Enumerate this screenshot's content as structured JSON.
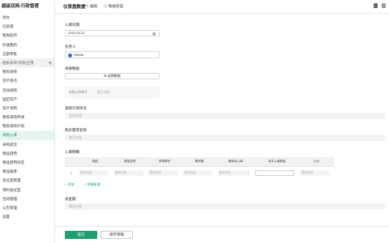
{
  "app": {
    "title": "超级双网-行政管理"
  },
  "sidebar": {
    "items": [
      {
        "label": "待办"
      },
      {
        "label": "已处理"
      },
      {
        "label": "我发起的"
      },
      {
        "label": "抄送我的"
      },
      {
        "label": "全部审批"
      },
      {
        "label": "搜索表单/流程/应用"
      },
      {
        "label": "物资采购"
      },
      {
        "label": "资产盘点"
      },
      {
        "label": "活动采购"
      },
      {
        "label": "固定资产"
      },
      {
        "label": "资产领用"
      },
      {
        "label": "物资采购申请"
      },
      {
        "label": "物资采购计划"
      },
      {
        "label": "采购入库"
      },
      {
        "label": "采购退货"
      },
      {
        "label": "物品借用"
      },
      {
        "label": "物品借用归还"
      },
      {
        "label": "物品报废"
      },
      {
        "label": "会议室管理"
      },
      {
        "label": "预约会议室"
      },
      {
        "label": "活动管理"
      },
      {
        "label": "公告管理"
      },
      {
        "label": "设置"
      }
    ],
    "plus": "+"
  },
  "topbar": {
    "title": "仪表盘数据",
    "edit": "✎ 编辑",
    "data": "▤ 数据管理"
  },
  "form": {
    "date_label": "入库日期",
    "date_value": "2024-05-22",
    "date_icon": "▦",
    "person_label": "负责人",
    "person_name": "Official",
    "related_label": "关联数据",
    "select_btn": "⊞ 选择数据",
    "sub_label1": "采购计划单号",
    "sub_value1": "暂无内容",
    "plan_label": "采购计划单号",
    "plan_placeholder": "暂无内容",
    "plan_name_label": "购买需求名称",
    "plan_name_placeholder": "暂无内容",
    "detail_label": "入库明细",
    "table": {
      "headers": [
        "",
        "物品",
        "物品名称",
        "采购单价",
        "需求数",
        "剩余待入库",
        "本次入库数量",
        "小计"
      ],
      "row": [
        "1",
        "暂无内容",
        "暂无内容",
        "暂无内容",
        "暂无内容",
        "暂无内容",
        "",
        "暂无内容"
      ]
    },
    "add_label": "+ 添加",
    "add2_label": "+ 快速新增",
    "total_label": "总金额",
    "total_placeholder": "暂无内容"
  },
  "buttons": {
    "submit": "提交",
    "draft": "保存草稿"
  },
  "colors": {
    "accent": "#1fa06d",
    "avatar": "#2f6fd6"
  }
}
